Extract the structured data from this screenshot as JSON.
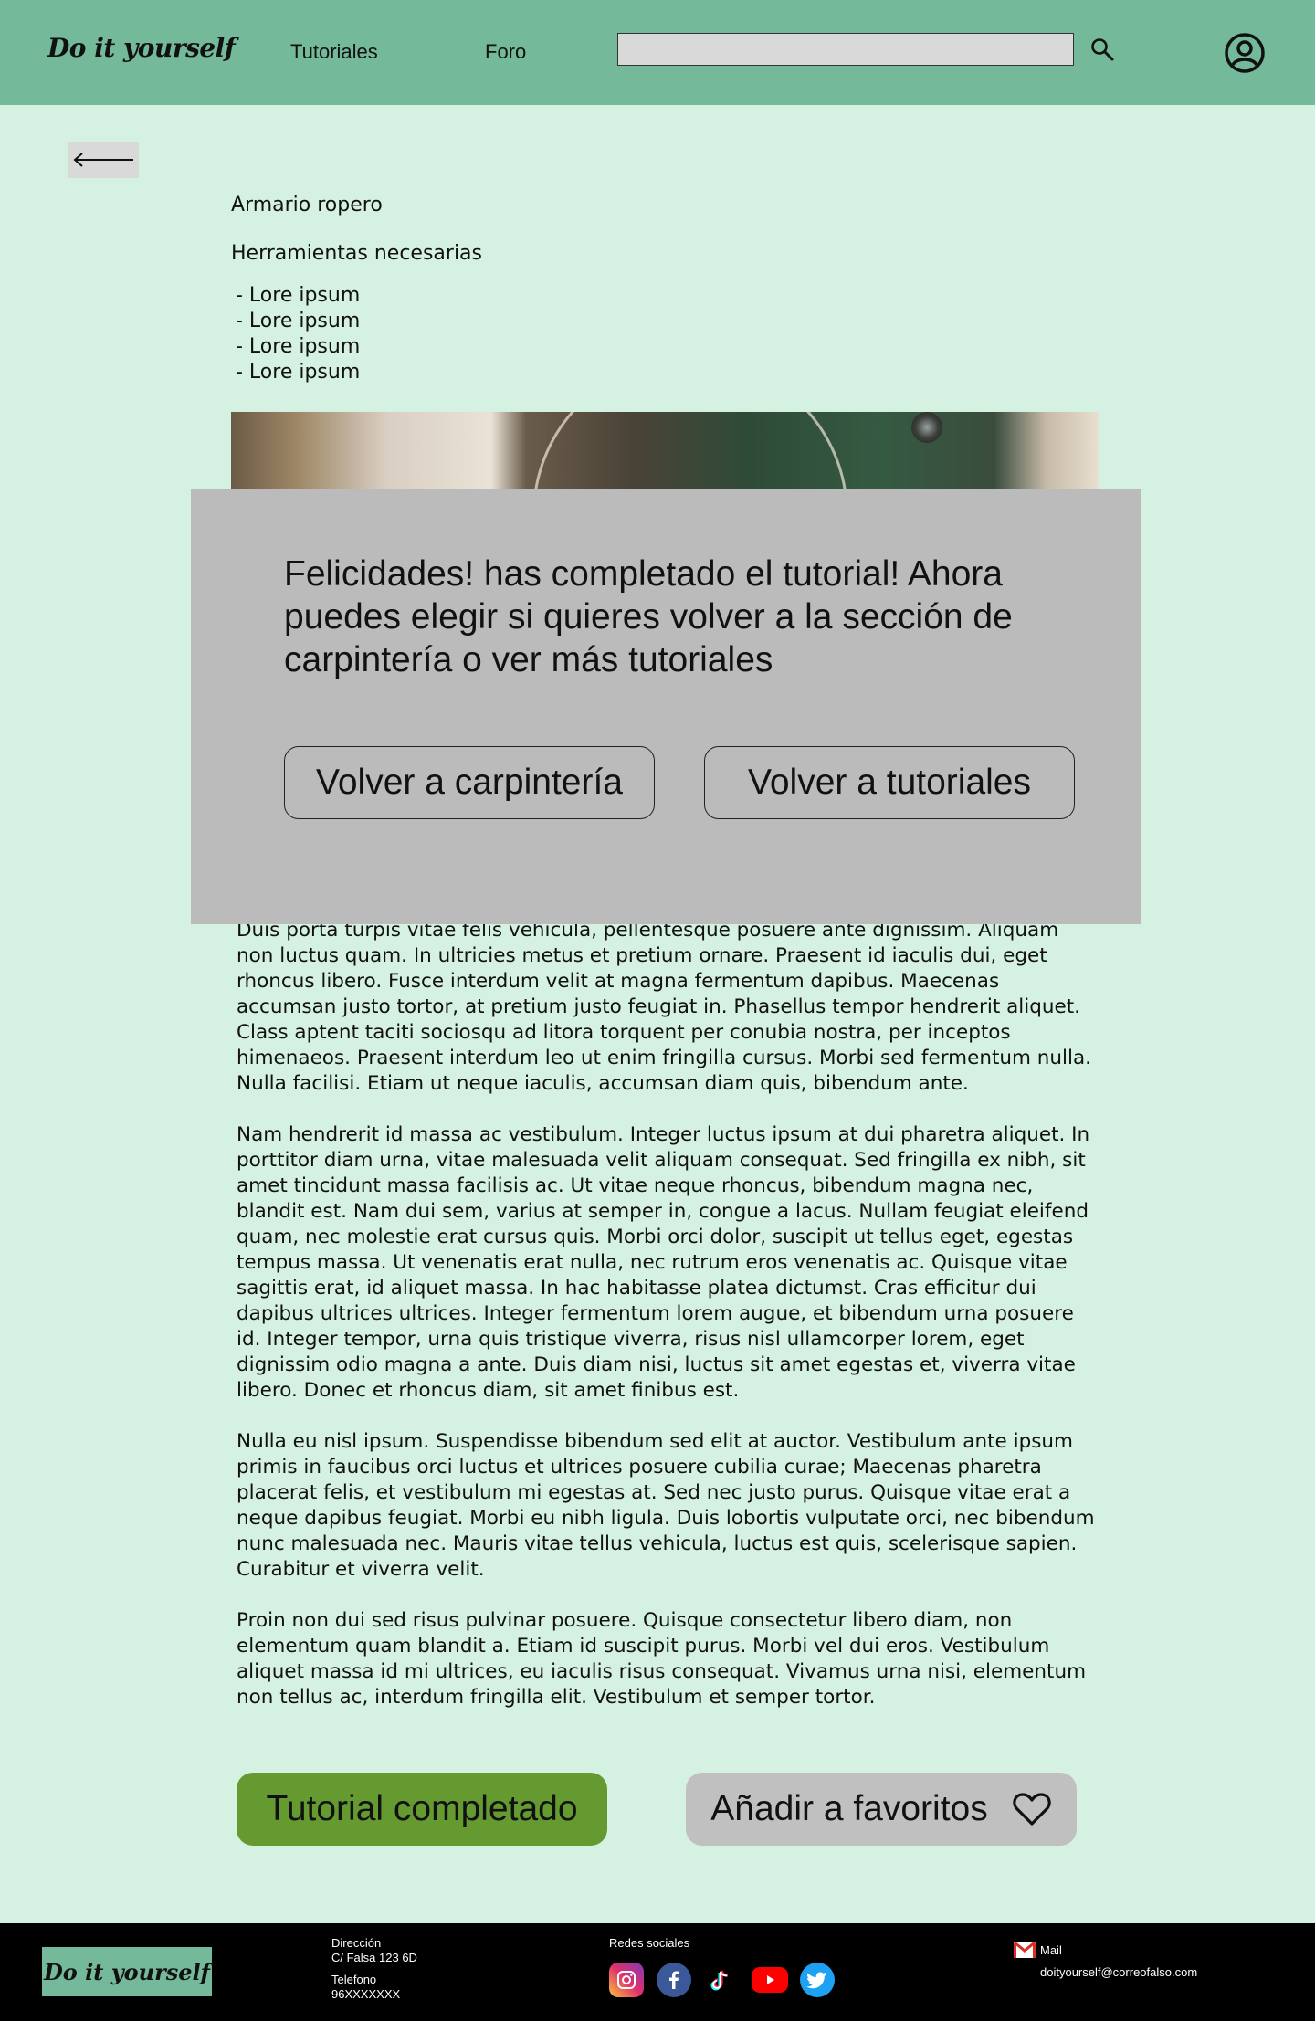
{
  "header": {
    "logo": "Do it yourself",
    "nav": [
      "Tutoriales",
      "Foro"
    ],
    "search_placeholder": "",
    "search_icon": "search-icon",
    "user_icon": "user-circle-icon",
    "bg_color": "#73b99a"
  },
  "back_icon": "arrow-left-icon",
  "article": {
    "title": "Armario ropero",
    "tools_heading": "Herramientas necesarias",
    "tools": [
      "- Lore ipsum",
      "- Lore ipsum",
      "- Lore ipsum",
      "- Lore ipsum"
    ],
    "paragraphs": [
      "Duis porta turpis vitae felis vehicula, pellentesque posuere ante dignissim. Aliquam non luctus quam. In ultricies metus et pretium ornare. Praesent id iaculis dui, eget rhoncus libero. Fusce interdum velit at magna fermentum dapibus. Maecenas accumsan justo tortor, at pretium justo feugiat in. Phasellus tempor hendrerit aliquet. Class aptent taciti sociosqu ad litora torquent per conubia nostra, per inceptos himenaeos. Praesent interdum leo ut enim fringilla cursus. Morbi sed fermentum nulla. Nulla facilisi. Etiam ut neque iaculis, accumsan diam quis, bibendum ante.",
      "Nam hendrerit id massa ac vestibulum. Integer luctus ipsum at dui pharetra aliquet. In porttitor diam urna, vitae malesuada velit aliquam consequat. Sed fringilla ex nibh, sit amet tincidunt massa facilisis ac. Ut vitae neque rhoncus, bibendum magna nec, blandit est. Nam dui sem, varius at semper in, congue a lacus. Nullam feugiat eleifend quam, nec molestie erat cursus quis. Morbi orci dolor, suscipit ut tellus eget, egestas tempus massa. Ut venenatis erat nulla, nec rutrum eros venenatis ac. Quisque vitae sagittis erat, id aliquet massa. In hac habitasse platea dictumst. Cras efficitur dui dapibus ultrices ultrices. Integer fermentum lorem augue, et bibendum urna posuere id. Integer tempor, urna quis tristique viverra, risus nisl ullamcorper lorem, eget dignissim odio magna a ante. Duis diam nisi, luctus sit amet egestas et, viverra vitae libero. Donec et rhoncus diam, sit amet finibus est.",
      "Nulla eu nisl ipsum. Suspendisse bibendum sed elit at auctor. Vestibulum ante ipsum primis in faucibus orci luctus et ultrices posuere cubilia curae; Maecenas pharetra placerat felis, et vestibulum mi egestas at. Sed nec justo purus. Quisque vitae erat a neque dapibus feugiat. Morbi eu nibh ligula. Duis lobortis vulputate orci, nec bibendum nunc malesuada nec. Mauris vitae tellus vehicula, luctus est quis, scelerisque sapien. Curabitur et viverra velit.",
      "Proin non dui sed risus pulvinar posuere. Quisque consectetur libero diam, non elementum quam blandit a. Etiam id suscipit purus. Morbi vel dui eros. Vestibulum aliquet massa id mi ultrices, eu iaculis risus consequat. Vivamus urna nisi, elementum non tellus ac, interdum fringilla elit. Vestibulum et semper tortor."
    ],
    "complete_label": "Tutorial completado",
    "favorite_label": "Añadir a favoritos",
    "favorite_icon": "heart-icon",
    "complete_color": "#659a31"
  },
  "modal": {
    "message": "Felicidades! has completado el tutorial! Ahora puedes elegir si quieres volver a la sección de carpintería o ver más tutoriales",
    "btn_carpentry": "Volver a carpintería",
    "btn_tutorials": "Volver a tutoriales"
  },
  "footer": {
    "logo": "Do it yourself",
    "address_label": "Dirección",
    "address": "C/ Falsa 123 6D",
    "phone_label": "Telefono",
    "phone": "96XXXXXXX",
    "social_label": "Redes sociales",
    "social": [
      "instagram-icon",
      "facebook-icon",
      "tiktok-icon",
      "youtube-icon",
      "twitter-icon"
    ],
    "mail_label": "Mail",
    "mail": "doityourself@correofalso.com"
  }
}
